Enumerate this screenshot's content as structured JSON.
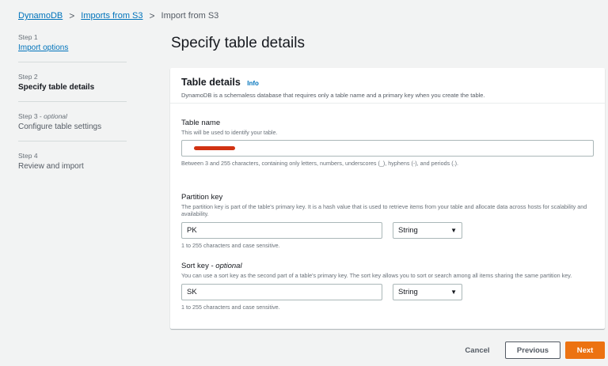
{
  "breadcrumb": {
    "items": [
      "DynamoDB",
      "Imports from S3",
      "Import from S3"
    ],
    "separator": ">"
  },
  "steps": [
    {
      "label": "Step 1",
      "optional": "",
      "title": "Import options"
    },
    {
      "label": "Step 2",
      "optional": "",
      "title": "Specify table details"
    },
    {
      "label": "Step 3 - ",
      "optional": "optional",
      "title": "Configure table settings"
    },
    {
      "label": "Step 4",
      "optional": "",
      "title": "Review and import"
    }
  ],
  "page_title": "Specify table details",
  "panel": {
    "title": "Table details",
    "info": "Info",
    "description": "DynamoDB is a schemaless database that requires only a table name and a primary key when you create the table."
  },
  "table_name": {
    "label": "Table name",
    "description": "This will be used to identify your table.",
    "value": "",
    "hint": "Between 3 and 255 characters, containing only letters, numbers, underscores (_), hyphens (-), and periods (.)."
  },
  "partition_key": {
    "label": "Partition key",
    "description": "The partition key is part of the table's primary key. It is a hash value that is used to retrieve items from your table and allocate data across hosts for scalability and availability.",
    "value": "PK",
    "type": "String",
    "hint": "1 to 255 characters and case sensitive."
  },
  "sort_key": {
    "label": "Sort key - ",
    "label_optional": "optional",
    "description": "You can use a sort key as the second part of a table's primary key. The sort key allows you to sort or search among all items sharing the same partition key.",
    "value": "SK",
    "type": "String",
    "hint": "1 to 255 characters and case sensitive."
  },
  "footer": {
    "cancel": "Cancel",
    "previous": "Previous",
    "next": "Next"
  },
  "colors": {
    "link": "#0073bb",
    "primary_button": "#ec7211",
    "redaction": "#d13212"
  }
}
